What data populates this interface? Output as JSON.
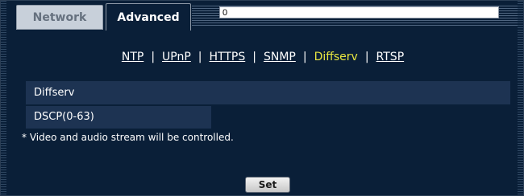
{
  "tabs": [
    {
      "label": "Network",
      "active": false
    },
    {
      "label": "Advanced",
      "active": true
    }
  ],
  "nav": {
    "links": [
      "NTP",
      "UPnP",
      "HTTPS",
      "SNMP",
      "Diffserv",
      "RTSP"
    ],
    "separator": "|",
    "active": "Diffserv",
    "active_color": "#e8e640"
  },
  "section": {
    "title": "Diffserv",
    "field_label": "DSCP(0-63)",
    "field_value": "0"
  },
  "note": "* Video and audio stream will be controlled.",
  "set_button": "Set",
  "colors": {
    "background": "#0a1f38",
    "panel": "#1d3352"
  }
}
